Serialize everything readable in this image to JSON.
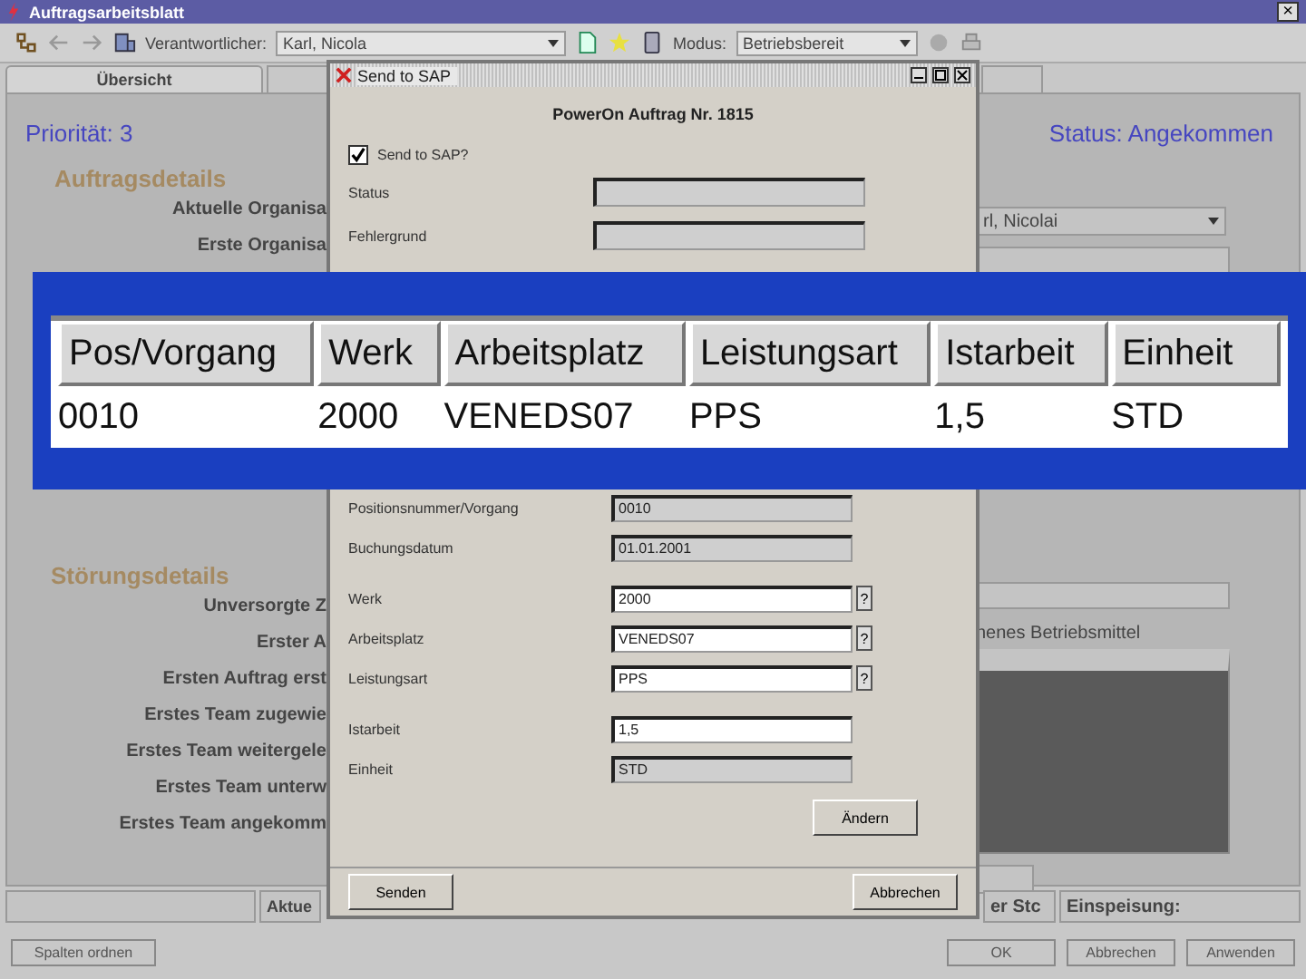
{
  "window": {
    "title": "Auftragsarbeitsblatt",
    "close": "×"
  },
  "toolbar": {
    "responsible_label": "Verantwortlicher:",
    "responsible": "Karl, Nicola",
    "mode_label": "Modus:",
    "mode": "Betriebsbereit"
  },
  "tabs": [
    {
      "label": "Übersicht",
      "selected": true
    }
  ],
  "summary": {
    "priority": "Priorität: 3",
    "status": "Status: Angekommen"
  },
  "order_details": {
    "heading": "Auftragsdetails",
    "labels": [
      "Aktuelle Organisa",
      "Erste Organisa"
    ],
    "responsible": "rl, Nicolai"
  },
  "fault_details": {
    "heading": "Störungsdetails",
    "labels": [
      "Unversorgte Z",
      "Erster A",
      "Ersten Auftrag erst",
      "Erstes Team zugewie",
      "Erstes Team weitergele",
      "Erstes Team unterw",
      "Erstes Team angekomm"
    ],
    "equipment_label": "nenes Betriebsmittel"
  },
  "status_bar": {
    "left": "Aktue",
    "middle": "er Stc",
    "right": "Einspeisung:"
  },
  "footer_buttons": {
    "left": "Spalten ordnen",
    "right": [
      "OK",
      "Abbrechen",
      "Anwenden"
    ]
  },
  "dialog": {
    "title": "Send to SAP",
    "heading": "PowerOn Auftrag Nr. 1815",
    "checkbox": {
      "label": "Send to SAP?",
      "checked": true
    },
    "fields_top": [
      {
        "label": "Status",
        "kind": "readonly"
      },
      {
        "label": "Fehlergrund",
        "kind": "readonly"
      }
    ],
    "fields_bottom": [
      {
        "label": "Positionsnummer/Vorgang",
        "value": "0010",
        "kind": "readonly"
      },
      {
        "label": "Buchungsdatum",
        "value": "01.01.2001",
        "kind": "readonly"
      },
      {
        "label": "Werk",
        "value": "2000",
        "kind": "lookup",
        "button": "?"
      },
      {
        "label": "Arbeitsplatz",
        "value": "VENEDS07",
        "kind": "lookup",
        "button": "?"
      },
      {
        "label": "Leistungsart",
        "value": "PPS",
        "kind": "lookup",
        "button": "?"
      },
      {
        "label": "Istarbeit",
        "value": "1,5",
        "kind": "input"
      },
      {
        "label": "Einheit",
        "value": "STD",
        "kind": "readonly"
      }
    ],
    "change_button": "Ändern",
    "send_button": "Senden",
    "cancel_button": "Abbrechen"
  },
  "overlay_table": {
    "columns": [
      "Pos/Vorgang",
      "Werk",
      "Arbeitsplatz",
      "Leistungsart",
      "Istarbeit",
      "Einheit"
    ],
    "rows": [
      [
        "0010",
        "2000",
        "VENEDS07",
        "PPS",
        "1,5",
        "STD"
      ]
    ]
  }
}
